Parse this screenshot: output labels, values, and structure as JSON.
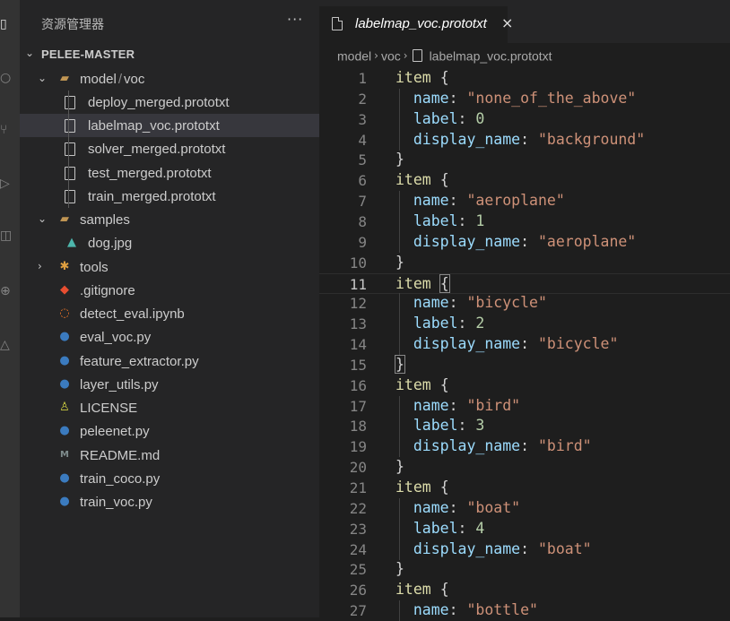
{
  "activity_bar": {
    "icons": [
      "files-icon",
      "search-icon",
      "source-control-icon",
      "run-icon",
      "extensions-icon",
      "remote-icon",
      "accounts-icon"
    ]
  },
  "sidebar": {
    "title": "资源管理器",
    "more_label": "···",
    "section_label": "PELEE-MASTER",
    "tree": [
      {
        "label": "model",
        "suffix": "voc",
        "sep": "/",
        "type": "folder-open",
        "depth": 1,
        "icon": "folder-open-icon"
      },
      {
        "label": "deploy_merged.prototxt",
        "type": "file",
        "depth": 2,
        "icon": "file-icon"
      },
      {
        "label": "labelmap_voc.prototxt",
        "type": "file",
        "depth": 2,
        "icon": "file-icon",
        "selected": true
      },
      {
        "label": "solver_merged.prototxt",
        "type": "file",
        "depth": 2,
        "icon": "file-icon"
      },
      {
        "label": "test_merged.prototxt",
        "type": "file",
        "depth": 2,
        "icon": "file-icon"
      },
      {
        "label": "train_merged.prototxt",
        "type": "file",
        "depth": 2,
        "icon": "file-icon"
      },
      {
        "label": "samples",
        "type": "folder-open",
        "depth": 1,
        "icon": "folder-open-icon"
      },
      {
        "label": "dog.jpg",
        "type": "image",
        "depth": 2,
        "icon": "image-file-icon"
      },
      {
        "label": "tools",
        "type": "folder-closed",
        "depth": 1,
        "icon": "tools-folder-icon"
      },
      {
        "label": ".gitignore",
        "type": "git",
        "depth": 1,
        "icon": "git-icon"
      },
      {
        "label": "detect_eval.ipynb",
        "type": "jupyter",
        "depth": 1,
        "icon": "jupyter-icon"
      },
      {
        "label": "eval_voc.py",
        "type": "python",
        "depth": 1,
        "icon": "python-icon"
      },
      {
        "label": "feature_extractor.py",
        "type": "python",
        "depth": 1,
        "icon": "python-icon"
      },
      {
        "label": "layer_utils.py",
        "type": "python",
        "depth": 1,
        "icon": "python-icon"
      },
      {
        "label": "LICENSE",
        "type": "license",
        "depth": 1,
        "icon": "license-icon"
      },
      {
        "label": "peleenet.py",
        "type": "python",
        "depth": 1,
        "icon": "python-icon"
      },
      {
        "label": "README.md",
        "type": "markdown",
        "depth": 1,
        "icon": "markdown-icon"
      },
      {
        "label": "train_coco.py",
        "type": "python",
        "depth": 1,
        "icon": "python-icon"
      },
      {
        "label": "train_voc.py",
        "type": "python",
        "depth": 1,
        "icon": "python-icon"
      }
    ]
  },
  "editor": {
    "tab": {
      "label": "labelmap_voc.prototxt",
      "close": "×"
    },
    "breadcrumb": [
      "model",
      "voc",
      "labelmap_voc.prototxt"
    ],
    "current_line": 11,
    "lines": [
      {
        "n": "1",
        "text": "item {"
      },
      {
        "n": "2",
        "text": "  name: \"none_of_the_above\""
      },
      {
        "n": "3",
        "text": "  label: 0"
      },
      {
        "n": "4",
        "text": "  display_name: \"background\""
      },
      {
        "n": "5",
        "text": "}"
      },
      {
        "n": "6",
        "text": "item {"
      },
      {
        "n": "7",
        "text": "  name: \"aeroplane\""
      },
      {
        "n": "8",
        "text": "  label: 1"
      },
      {
        "n": "9",
        "text": "  display_name: \"aeroplane\""
      },
      {
        "n": "10",
        "text": "}"
      },
      {
        "n": "11",
        "text": "item {"
      },
      {
        "n": "12",
        "text": "  name: \"bicycle\""
      },
      {
        "n": "13",
        "text": "  label: 2"
      },
      {
        "n": "14",
        "text": "  display_name: \"bicycle\""
      },
      {
        "n": "15",
        "text": "}"
      },
      {
        "n": "16",
        "text": "item {"
      },
      {
        "n": "17",
        "text": "  name: \"bird\""
      },
      {
        "n": "18",
        "text": "  label: 3"
      },
      {
        "n": "19",
        "text": "  display_name: \"bird\""
      },
      {
        "n": "20",
        "text": "}"
      },
      {
        "n": "21",
        "text": "item {"
      },
      {
        "n": "22",
        "text": "  name: \"boat\""
      },
      {
        "n": "23",
        "text": "  label: 4"
      },
      {
        "n": "24",
        "text": "  display_name: \"boat\""
      },
      {
        "n": "25",
        "text": "}"
      },
      {
        "n": "26",
        "text": "item {"
      },
      {
        "n": "27",
        "text": "  name: \"bottle\""
      }
    ]
  },
  "colors": {
    "key": "#9cdcfe",
    "string": "#ce9178",
    "number": "#b5cea8",
    "keyword": "#dcdcaa",
    "punct": "#d4d4d4",
    "selected_row": "#37373d"
  }
}
